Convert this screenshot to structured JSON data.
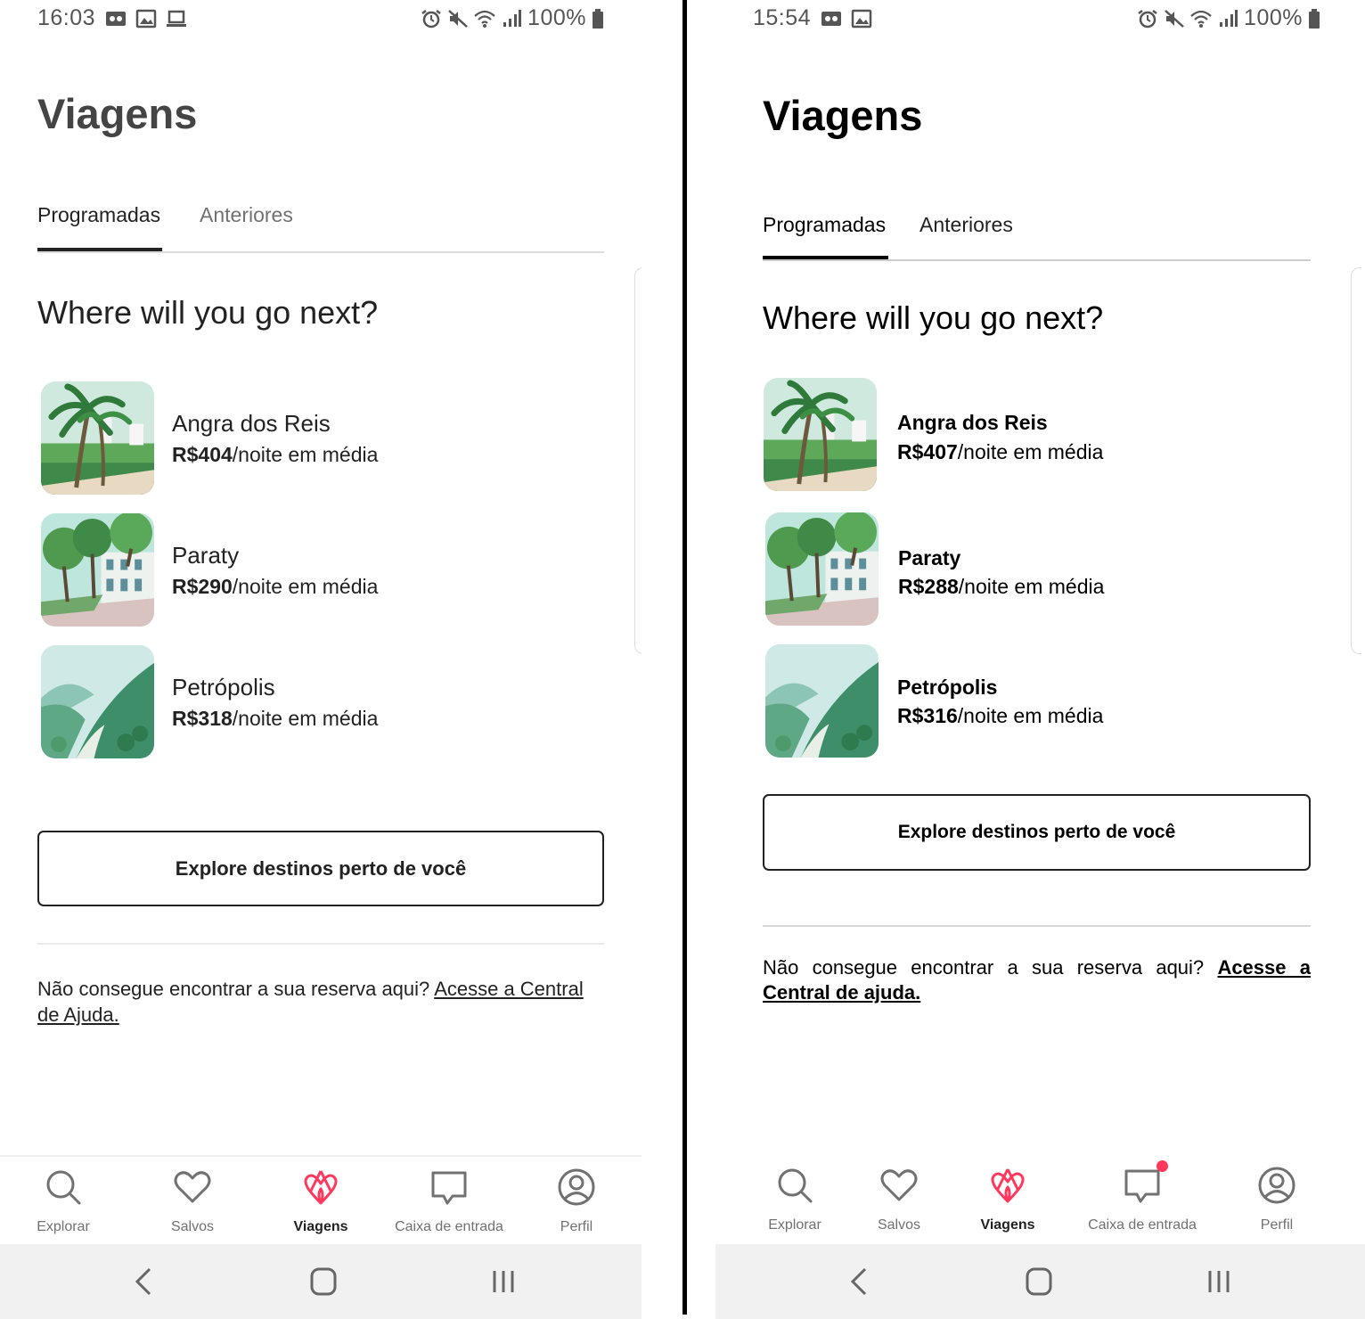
{
  "left": {
    "status": {
      "time": "16:03",
      "battery": "100%"
    },
    "title": "Viagens",
    "tabs": [
      "Programadas",
      "Anteriores"
    ],
    "heading": "Where will you go next?",
    "destinations": [
      {
        "name": "Angra dos Reis",
        "price": "R$404",
        "suffix": "/noite em média",
        "icon": "palm-trees-illustration"
      },
      {
        "name": "Paraty",
        "price": "R$290",
        "suffix": "/noite em média",
        "icon": "colonial-street-illustration"
      },
      {
        "name": "Petrópolis",
        "price": "R$318",
        "suffix": "/noite em média",
        "icon": "mountain-valley-illustration"
      }
    ],
    "explore_button": "Explore destinos perto de você",
    "help_text": "Não consegue encontrar a sua reserva aqui?",
    "help_link": "Acesse a Central de Ajuda.",
    "nav": [
      "Explorar",
      "Salvos",
      "Viagens",
      "Caixa de entrada",
      "Perfil"
    ]
  },
  "right": {
    "status": {
      "time": "15:54",
      "battery": "100%"
    },
    "title": "Viagens",
    "tabs": [
      "Programadas",
      "Anteriores"
    ],
    "heading": "Where will you go next?",
    "destinations": [
      {
        "name": "Angra dos Reis",
        "price": "R$407",
        "suffix": "/noite em média",
        "icon": "palm-trees-illustration"
      },
      {
        "name": "Paraty",
        "price": "R$288",
        "suffix": "/noite em média",
        "icon": "colonial-street-illustration"
      },
      {
        "name": "Petrópolis",
        "price": "R$316",
        "suffix": "/noite em média",
        "icon": "mountain-valley-illustration"
      }
    ],
    "explore_button": "Explore destinos perto de você",
    "help_text": "Não consegue encontrar a sua reserva aqui?",
    "help_link": "Acesse a Central de ajuda.",
    "nav": [
      "Explorar",
      "Salvos",
      "Viagens",
      "Caixa de entrada",
      "Perfil"
    ]
  },
  "colors": {
    "brand": "#ff385c",
    "text": "#222222",
    "muted": "#717171",
    "divider": "#dddddd",
    "sysbar": "#f1f1f1"
  }
}
